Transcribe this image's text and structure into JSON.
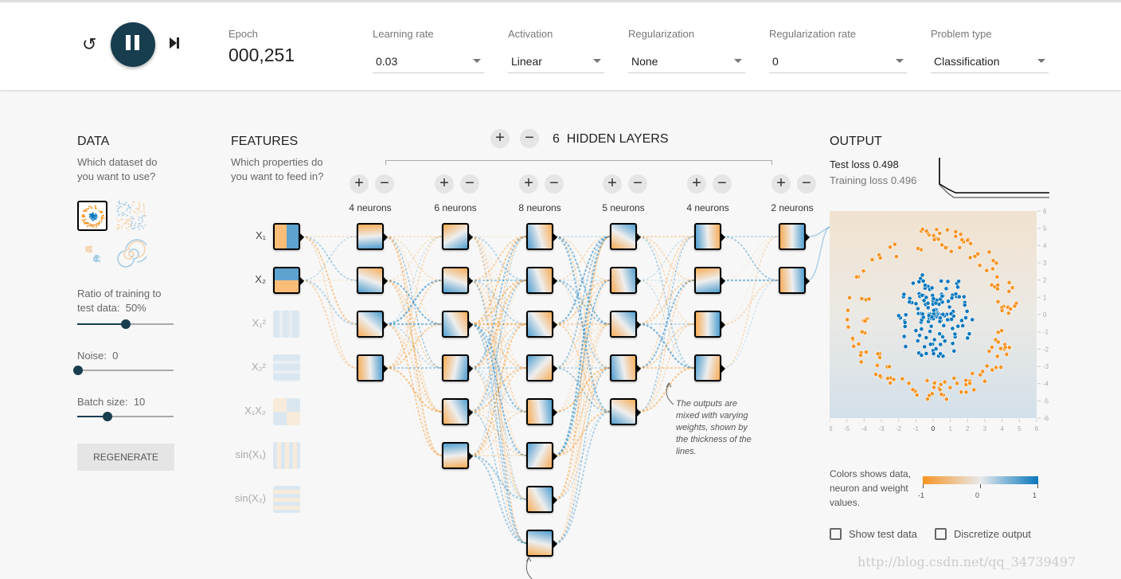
{
  "header": {
    "epoch_label": "Epoch",
    "epoch_value": "000,251",
    "controls": [
      {
        "label": "Learning rate",
        "value": "0.03"
      },
      {
        "label": "Activation",
        "value": "Linear"
      },
      {
        "label": "Regularization",
        "value": "None"
      },
      {
        "label": "Regularization rate",
        "value": "0"
      },
      {
        "label": "Problem type",
        "value": "Classification"
      }
    ],
    "icons": [
      "reset-icon",
      "pause-icon",
      "step-icon"
    ]
  },
  "data": {
    "title": "DATA",
    "question": "Which dataset do you want to use?",
    "datasets": [
      "circle",
      "xor",
      "gaussian",
      "spiral"
    ],
    "selected": "circle",
    "ratio_label": "Ratio of training to test data:",
    "ratio_value": "50%",
    "ratio": 50,
    "noise_label": "Noise:",
    "noise_value": "0",
    "noise": 0,
    "batch_label": "Batch size:",
    "batch_value": "10",
    "batch": 10,
    "regenerate": "REGENERATE"
  },
  "features": {
    "title": "FEATURES",
    "question": "Which properties do you want to feed in?",
    "items": [
      {
        "label": "X₁",
        "active": true
      },
      {
        "label": "X₂",
        "active": true
      },
      {
        "label": "X₁²",
        "active": false
      },
      {
        "label": "X₂²",
        "active": false
      },
      {
        "label": "X₁X₂",
        "active": false
      },
      {
        "label": "sin(X₁)",
        "active": false
      },
      {
        "label": "sin(X₂)",
        "active": false
      }
    ]
  },
  "network": {
    "layers_count": "6",
    "layers_label": "HIDDEN LAYERS",
    "layers": [
      {
        "label": "4 neurons",
        "n": 4
      },
      {
        "label": "6 neurons",
        "n": 6
      },
      {
        "label": "8 neurons",
        "n": 8
      },
      {
        "label": "5 neurons",
        "n": 5
      },
      {
        "label": "4 neurons",
        "n": 4
      },
      {
        "label": "2 neurons",
        "n": 2
      }
    ],
    "annotation": "The outputs are mixed with varying weights, shown by the thickness of the lines."
  },
  "output": {
    "title": "OUTPUT",
    "test_loss_label": "Test loss",
    "test_loss": "0.498",
    "train_loss_label": "Training loss",
    "train_loss": "0.496",
    "y_ticks": [
      "6",
      "5",
      "4",
      "3",
      "2",
      "1",
      "0",
      "-1",
      "-2",
      "-3",
      "-4",
      "-5",
      "-6"
    ],
    "x_ticks": [
      "-6",
      "-5",
      "-4",
      "-3",
      "-2",
      "-1",
      "0",
      "1",
      "2",
      "3",
      "4",
      "5",
      "6"
    ],
    "legend_text": "Colors shows data, neuron and weight values.",
    "legend_ticks": [
      "-1",
      "0",
      "1"
    ],
    "show_test": "Show test data",
    "discretize": "Discretize output"
  },
  "colors": {
    "orange": "#f59322",
    "blue": "#0877bd",
    "dark": "#183d4e"
  },
  "watermark": "http://blog.csdn.net/qq_34739497"
}
